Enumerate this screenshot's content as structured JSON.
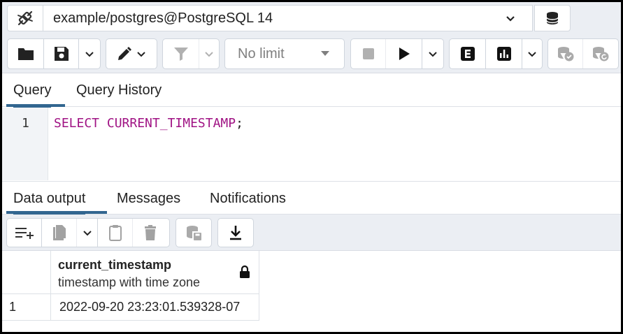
{
  "connection": {
    "label": "example/postgres@PostgreSQL 14",
    "connection_icon": "plug-disconnected-icon",
    "database_icon": "database-icon"
  },
  "toolbar": {
    "limit_label": "No limit",
    "icons": [
      "folder-icon",
      "save-icon",
      "chevron-down-icon",
      "pen-icon",
      "filter-icon",
      "stop-icon",
      "play-icon",
      "explain-icon",
      "explain-analyze-icon",
      "commit-icon",
      "rollback-icon"
    ]
  },
  "query_tabs": [
    {
      "label": "Query",
      "active": true
    },
    {
      "label": "Query History",
      "active": false
    }
  ],
  "editor": {
    "line_number": "1",
    "tokens": {
      "kw1": "SELECT",
      "space": " ",
      "kw2": "CURRENT_TIMESTAMP",
      "punct": ";"
    }
  },
  "result_tabs": [
    {
      "label": "Data output",
      "active": true
    },
    {
      "label": "Messages",
      "active": false
    },
    {
      "label": "Notifications",
      "active": false
    }
  ],
  "result_toolbar": {
    "icons": [
      "add-row-icon",
      "copy-icon",
      "chevron-down-icon",
      "paste-icon",
      "delete-icon",
      "save-data-icon",
      "download-icon"
    ]
  },
  "grid": {
    "columns": [
      {
        "name": "current_timestamp",
        "type": "timestamp with time zone",
        "locked": true
      }
    ],
    "rows": [
      {
        "row_number": "1",
        "values": [
          "2022-09-20 23:23:01.539328-07"
        ]
      }
    ]
  },
  "colors": {
    "accent": "#326690",
    "keyword": "#a01384",
    "toolbar_bg": "#ebeef3"
  }
}
